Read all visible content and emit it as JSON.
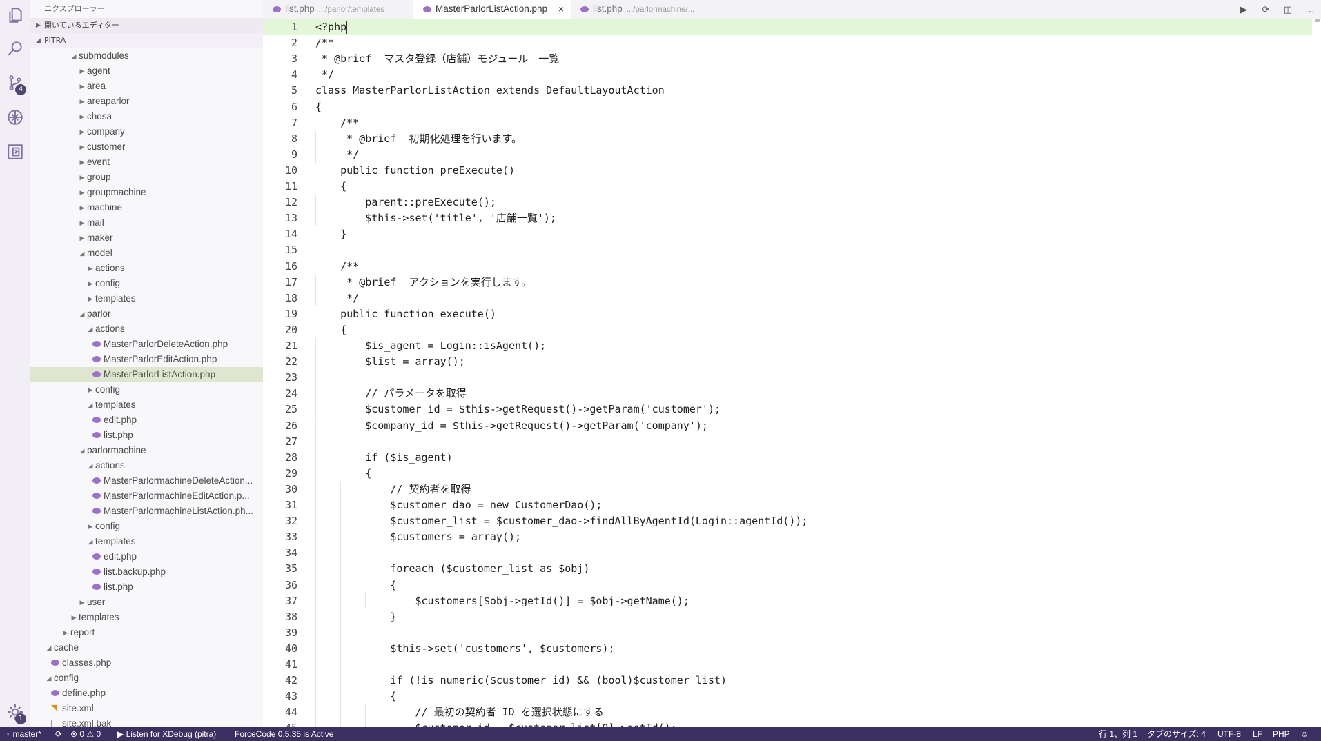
{
  "activity": {
    "scm_badge": "4",
    "settings_badge": "1"
  },
  "sidebar": {
    "title": "エクスプローラー",
    "open_editors": "開いているエディター",
    "project": "PITRA"
  },
  "tree": [
    {
      "label": "submodules",
      "indent": 4,
      "type": "folder",
      "open": true
    },
    {
      "label": "agent",
      "indent": 5,
      "type": "folder"
    },
    {
      "label": "area",
      "indent": 5,
      "type": "folder"
    },
    {
      "label": "areaparlor",
      "indent": 5,
      "type": "folder"
    },
    {
      "label": "chosa",
      "indent": 5,
      "type": "folder"
    },
    {
      "label": "company",
      "indent": 5,
      "type": "folder"
    },
    {
      "label": "customer",
      "indent": 5,
      "type": "folder"
    },
    {
      "label": "event",
      "indent": 5,
      "type": "folder"
    },
    {
      "label": "group",
      "indent": 5,
      "type": "folder"
    },
    {
      "label": "groupmachine",
      "indent": 5,
      "type": "folder"
    },
    {
      "label": "machine",
      "indent": 5,
      "type": "folder"
    },
    {
      "label": "mail",
      "indent": 5,
      "type": "folder"
    },
    {
      "label": "maker",
      "indent": 5,
      "type": "folder"
    },
    {
      "label": "model",
      "indent": 5,
      "type": "folder",
      "open": true
    },
    {
      "label": "actions",
      "indent": 6,
      "type": "folder"
    },
    {
      "label": "config",
      "indent": 6,
      "type": "folder"
    },
    {
      "label": "templates",
      "indent": 6,
      "type": "folder"
    },
    {
      "label": "parlor",
      "indent": 5,
      "type": "folder",
      "open": true
    },
    {
      "label": "actions",
      "indent": 6,
      "type": "folder",
      "open": true
    },
    {
      "label": "MasterParlorDeleteAction.php",
      "indent": 7,
      "type": "php"
    },
    {
      "label": "MasterParlorEditAction.php",
      "indent": 7,
      "type": "php"
    },
    {
      "label": "MasterParlorListAction.php",
      "indent": 7,
      "type": "php",
      "selected": true
    },
    {
      "label": "config",
      "indent": 6,
      "type": "folder"
    },
    {
      "label": "templates",
      "indent": 6,
      "type": "folder",
      "open": true
    },
    {
      "label": "edit.php",
      "indent": 7,
      "type": "php"
    },
    {
      "label": "list.php",
      "indent": 7,
      "type": "php"
    },
    {
      "label": "parlormachine",
      "indent": 5,
      "type": "folder",
      "open": true
    },
    {
      "label": "actions",
      "indent": 6,
      "type": "folder",
      "open": true
    },
    {
      "label": "MasterParlormachineDeleteAction...",
      "indent": 7,
      "type": "php"
    },
    {
      "label": "MasterParlormachineEditAction.p...",
      "indent": 7,
      "type": "php"
    },
    {
      "label": "MasterParlormachineListAction.ph...",
      "indent": 7,
      "type": "php"
    },
    {
      "label": "config",
      "indent": 6,
      "type": "folder"
    },
    {
      "label": "templates",
      "indent": 6,
      "type": "folder",
      "open": true
    },
    {
      "label": "edit.php",
      "indent": 7,
      "type": "php"
    },
    {
      "label": "list.backup.php",
      "indent": 7,
      "type": "php"
    },
    {
      "label": "list.php",
      "indent": 7,
      "type": "php"
    },
    {
      "label": "user",
      "indent": 5,
      "type": "folder"
    },
    {
      "label": "templates",
      "indent": 4,
      "type": "folder"
    },
    {
      "label": "report",
      "indent": 3,
      "type": "folder"
    },
    {
      "label": "cache",
      "indent": 1,
      "type": "folder",
      "open": true
    },
    {
      "label": "classes.php",
      "indent": 2,
      "type": "php"
    },
    {
      "label": "config",
      "indent": 1,
      "type": "folder",
      "open": true
    },
    {
      "label": "define.php",
      "indent": 2,
      "type": "php"
    },
    {
      "label": "site.xml",
      "indent": 2,
      "type": "rss"
    },
    {
      "label": "site.xml.bak",
      "indent": 2,
      "type": "file"
    }
  ],
  "tabs": [
    {
      "name": "list.php",
      "path": ".../parlor/templates",
      "active": false
    },
    {
      "name": "MasterParlorListAction.php",
      "path": "",
      "active": true,
      "close": "×"
    },
    {
      "name": "list.php",
      "path": ".../parlormachine/...",
      "active": false
    }
  ],
  "tab_actions": [
    "▶",
    "⟳",
    "◫",
    "…"
  ],
  "code": [
    {
      "n": "1",
      "t": "<?php",
      "i": 0
    },
    {
      "n": "2",
      "t": "/**",
      "i": 0
    },
    {
      "n": "3",
      "t": " * @brief  マスタ登録（店舗）モジュール　一覧",
      "i": 0
    },
    {
      "n": "4",
      "t": " */",
      "i": 0
    },
    {
      "n": "5",
      "t": "class MasterParlorListAction extends DefaultLayoutAction",
      "i": 0
    },
    {
      "n": "6",
      "t": "{",
      "i": 0
    },
    {
      "n": "7",
      "t": "    /**",
      "i": 0
    },
    {
      "n": "8",
      "t": "     * @brief  初期化処理を行います。",
      "i": 1
    },
    {
      "n": "9",
      "t": "     */",
      "i": 1
    },
    {
      "n": "10",
      "t": "    public function preExecute()",
      "i": 0
    },
    {
      "n": "11",
      "t": "    {",
      "i": 0
    },
    {
      "n": "12",
      "t": "        parent::preExecute();",
      "i": 1
    },
    {
      "n": "13",
      "t": "        $this->set('title', '店舗一覧');",
      "i": 1
    },
    {
      "n": "14",
      "t": "    }",
      "i": 0
    },
    {
      "n": "15",
      "t": "",
      "i": 0
    },
    {
      "n": "16",
      "t": "    /**",
      "i": 0
    },
    {
      "n": "17",
      "t": "     * @brief  アクションを実行します。",
      "i": 1
    },
    {
      "n": "18",
      "t": "     */",
      "i": 1
    },
    {
      "n": "19",
      "t": "    public function execute()",
      "i": 0
    },
    {
      "n": "20",
      "t": "    {",
      "i": 0
    },
    {
      "n": "21",
      "t": "        $is_agent = Login::isAgent();",
      "i": 1
    },
    {
      "n": "22",
      "t": "        $list = array();",
      "i": 1
    },
    {
      "n": "23",
      "t": "",
      "i": 1
    },
    {
      "n": "24",
      "t": "        // パラメータを取得",
      "i": 1
    },
    {
      "n": "25",
      "t": "        $customer_id = $this->getRequest()->getParam('customer');",
      "i": 1
    },
    {
      "n": "26",
      "t": "        $company_id = $this->getRequest()->getParam('company');",
      "i": 1
    },
    {
      "n": "27",
      "t": "",
      "i": 1
    },
    {
      "n": "28",
      "t": "        if ($is_agent)",
      "i": 1
    },
    {
      "n": "29",
      "t": "        {",
      "i": 1
    },
    {
      "n": "30",
      "t": "            // 契約者を取得",
      "i": 2
    },
    {
      "n": "31",
      "t": "            $customer_dao = new CustomerDao();",
      "i": 2
    },
    {
      "n": "32",
      "t": "            $customer_list = $customer_dao->findAllByAgentId(Login::agentId());",
      "i": 2
    },
    {
      "n": "33",
      "t": "            $customers = array();",
      "i": 2
    },
    {
      "n": "34",
      "t": "",
      "i": 2
    },
    {
      "n": "35",
      "t": "            foreach ($customer_list as $obj)",
      "i": 2
    },
    {
      "n": "36",
      "t": "            {",
      "i": 2
    },
    {
      "n": "37",
      "t": "                $customers[$obj->getId()] = $obj->getName();",
      "i": 3
    },
    {
      "n": "38",
      "t": "            }",
      "i": 2
    },
    {
      "n": "39",
      "t": "",
      "i": 2
    },
    {
      "n": "40",
      "t": "            $this->set('customers', $customers);",
      "i": 2
    },
    {
      "n": "41",
      "t": "",
      "i": 2
    },
    {
      "n": "42",
      "t": "            if (!is_numeric($customer_id) && (bool)$customer_list)",
      "i": 2
    },
    {
      "n": "43",
      "t": "            {",
      "i": 2
    },
    {
      "n": "44",
      "t": "                // 最初の契約者 ID を選択状態にする",
      "i": 3
    },
    {
      "n": "45",
      "t": "                $customer_id = $customer_list[0]->getId();",
      "i": 3
    }
  ],
  "status": {
    "branch": "master*",
    "sync": "⟳",
    "problems": "⊗ 0 ⚠ 0",
    "xdebug": "▶ Listen for XDebug (pitra)",
    "forcecode": "ForceCode 0.5.35 is Active",
    "position": "行 1、列 1",
    "tab_size": "タブのサイズ: 4",
    "encoding": "UTF-8",
    "eol": "LF",
    "language": "PHP",
    "feedback": "☺",
    "bell": "🔔"
  }
}
